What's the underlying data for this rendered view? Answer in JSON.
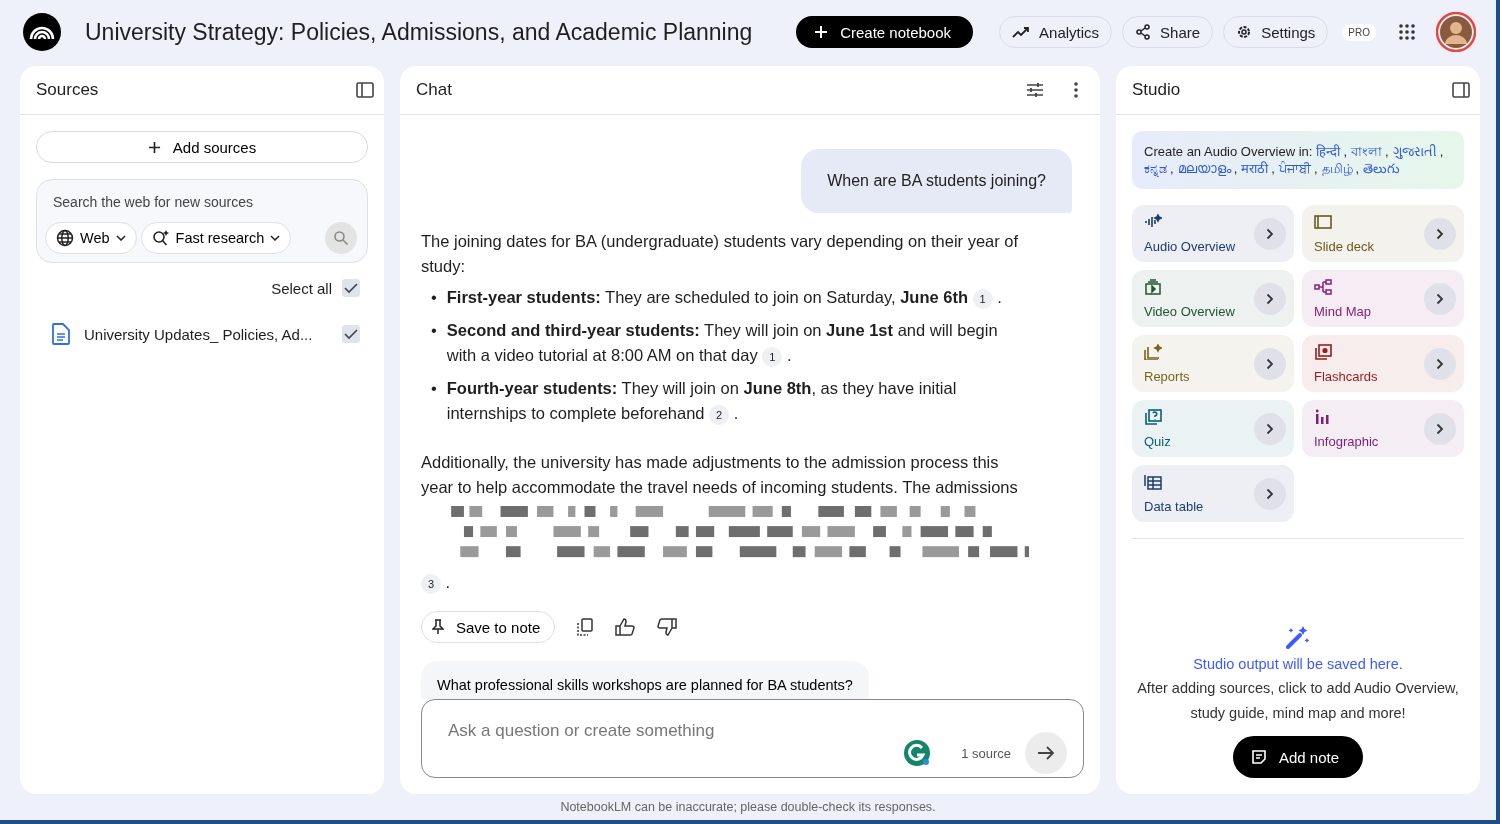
{
  "header": {
    "title": "University Strategy: Policies, Admissions, and Academic Planning",
    "create_button": "Create notebook",
    "actions": [
      {
        "kind": "analytics",
        "label": "Analytics"
      },
      {
        "kind": "share",
        "label": "Share"
      },
      {
        "kind": "settings",
        "label": "Settings"
      }
    ],
    "badge": "PRO"
  },
  "sources": {
    "title": "Sources",
    "add_button": "Add sources",
    "search": {
      "placeholder": "Search the web for new sources",
      "web_dropdown": "Web",
      "mode_dropdown": "Fast research"
    },
    "select_all": {
      "label": "Select all",
      "checked": true
    },
    "items": [
      {
        "name": "University Updates_ Policies, Ad...",
        "checked": true
      }
    ]
  },
  "chat": {
    "title": "Chat",
    "user_message": "When are BA students joining?",
    "answer_intro": "The joining dates for BA (undergraduate) students vary depending on their year of study:",
    "bullets": [
      {
        "marker": "•",
        "text": "**First-year students:** They are scheduled to join on Saturday, **June 6th**",
        "citation": "1",
        "after": "."
      },
      {
        "marker": "•",
        "text": "**Second and third-year students:** They will join on **June 1st** and will begin with a video tutorial at 8:00 AM on that day",
        "citation": "1",
        "after": "."
      },
      {
        "marker": "•",
        "text": "**Fourth-year students:** They will join on **June 8th**, as they have initial internships to complete beforehand",
        "citation": "2",
        "after": "."
      }
    ],
    "answer_more": "Additionally, the university has made adjustments to the admission process this year to help accommodate the travel needs of incoming students. The admissions",
    "final_citation": "3",
    "final_after": ".",
    "save_button": "Save to note",
    "suggestion": "What professional skills workshops are planned for BA students?",
    "input": {
      "placeholder": "Ask a question or create something",
      "source_count": "1 source"
    }
  },
  "studio": {
    "title": "Studio",
    "languages_intro": "Create an Audio Overview in:",
    "separator": ",",
    "languages": [
      "हिन्दी",
      "বাংলা",
      "ગુજરાતી",
      "ಕನ್ನಡ",
      "മലയാളം",
      "मराठी",
      "ਪੰਜਾਬੀ",
      "தமிழ்",
      "తెలుగు"
    ],
    "cards": [
      {
        "kind": "audio",
        "label": "Audio Overview",
        "color": "#1f3b73"
      },
      {
        "kind": "slides",
        "label": "Slide deck",
        "color": "#6b5a1e"
      },
      {
        "kind": "video",
        "label": "Video Overview",
        "color": "#1e5631"
      },
      {
        "kind": "mindmap",
        "label": "Mind Map",
        "color": "#8a1f7a"
      },
      {
        "kind": "reports",
        "label": "Reports",
        "color": "#7a6320"
      },
      {
        "kind": "flashcards",
        "label": "Flashcards",
        "color": "#9b1c1c"
      },
      {
        "kind": "quiz",
        "label": "Quiz",
        "color": "#0b5f7a"
      },
      {
        "kind": "infographic",
        "label": "Infographic",
        "color": "#7b1f78"
      },
      {
        "kind": "table",
        "label": "Data table",
        "color": "#1f3b73"
      }
    ],
    "empty_title": "Studio output will be saved here.",
    "empty_text": "After adding sources, click to add Audio Overview, study guide, mind map and more!",
    "add_note": "Add note"
  },
  "footer": "NotebookLM can be inaccurate; please double-check its responses."
}
